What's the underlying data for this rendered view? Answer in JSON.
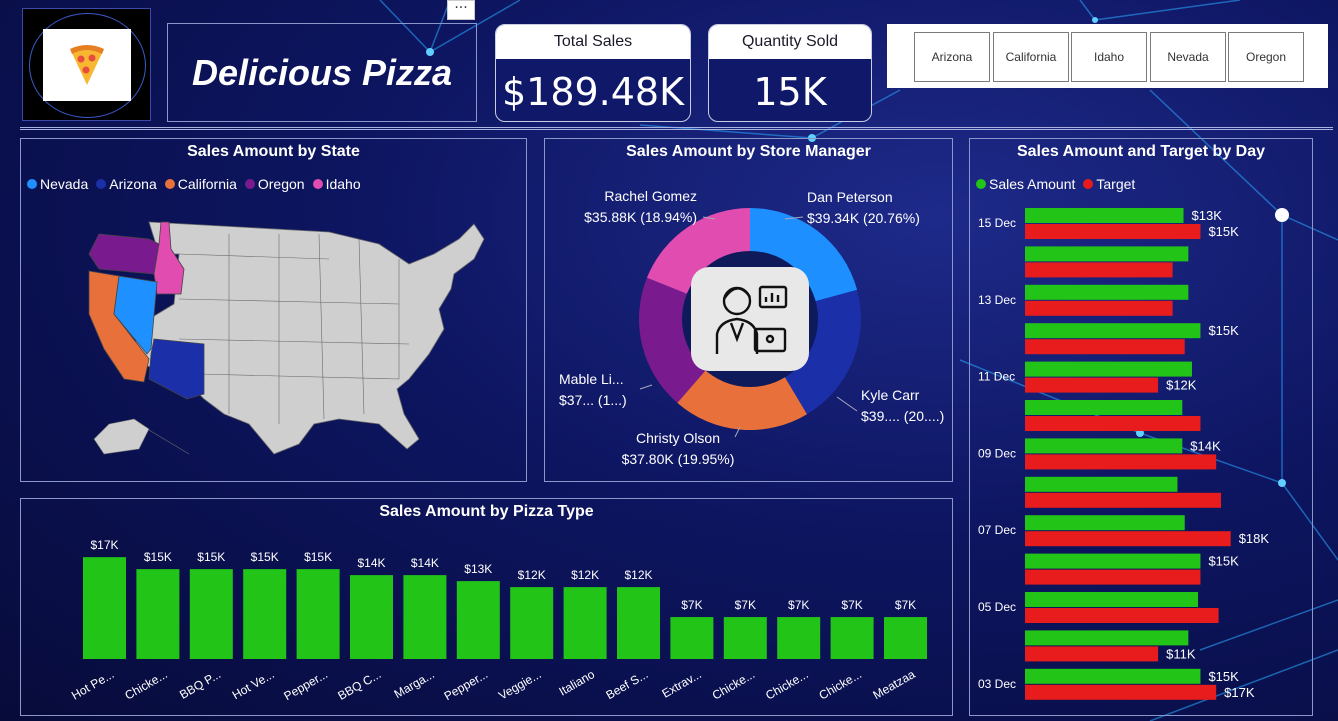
{
  "header": {
    "title": "Delicious Pizza",
    "logo_icon": "pizza-icon",
    "more_options": "···"
  },
  "kpis": [
    {
      "label": "Total Sales",
      "value": "$189.48K"
    },
    {
      "label": "Quantity Sold",
      "value": "15K"
    }
  ],
  "slicer": {
    "states": [
      "Arizona",
      "California",
      "Idaho",
      "Nevada",
      "Oregon"
    ]
  },
  "map_panel": {
    "title": "Sales Amount by State",
    "legend": [
      {
        "label": "Nevada",
        "color": "#1e90ff"
      },
      {
        "label": "Arizona",
        "color": "#1a2fa8"
      },
      {
        "label": "California",
        "color": "#e8703a"
      },
      {
        "label": "Oregon",
        "color": "#7a1a8f"
      },
      {
        "label": "Idaho",
        "color": "#e04cb0"
      }
    ]
  },
  "donut_panel": {
    "title": "Sales Amount by Store Manager",
    "center_icon": "business-person-icon",
    "slices": [
      {
        "name": "Dan Peterson",
        "value_label": "$39.34K (20.76%)",
        "value": 39.34,
        "color": "#1e8fff"
      },
      {
        "name": "Kyle Carr",
        "value_label": "$39.... (20....)",
        "value": 39.1,
        "color": "#1a2fa8"
      },
      {
        "name": "Christy Olson",
        "value_label": "$37.80K (19.95%)",
        "value": 37.8,
        "color": "#e8703a"
      },
      {
        "name": "Mable Li...",
        "value_label": "$37... (1...)",
        "value": 37.3,
        "color": "#7a1a8f"
      },
      {
        "name": "Rachel Gomez",
        "value_label": "$35.88K (18.94%)",
        "value": 35.88,
        "color": "#e04cb0"
      }
    ]
  },
  "pizza_panel": {
    "title": "Sales Amount by Pizza Type"
  },
  "day_panel": {
    "title": "Sales Amount and Target by Day",
    "legend": [
      {
        "label": "Sales Amount",
        "color": "#22c418"
      },
      {
        "label": "Target",
        "color": "#e81c1c"
      }
    ]
  },
  "chart_data": [
    {
      "type": "bar",
      "title": "Sales Amount by Pizza Type",
      "categories": [
        "Hot Pe...",
        "Chicke...",
        "BBQ P...",
        "Hot Ve...",
        "Pepper...",
        "BBQ C...",
        "Marga...",
        "Pepper...",
        "Veggie...",
        "Italiano",
        "Beef S...",
        "Extrav...",
        "Chicke...",
        "Chicke...",
        "Chicke...",
        "Meatzaa"
      ],
      "values": [
        17,
        15,
        15,
        15,
        15,
        14,
        14,
        13,
        12,
        12,
        12,
        7,
        7,
        7,
        7,
        7
      ],
      "value_labels": [
        "$17K",
        "$15K",
        "$15K",
        "$15K",
        "$15K",
        "$14K",
        "$14K",
        "$13K",
        "$12K",
        "$12K",
        "$12K",
        "$7K",
        "$7K",
        "$7K",
        "$7K",
        "$7K"
      ],
      "color": "#22c418",
      "ylim": [
        0,
        20
      ]
    },
    {
      "type": "bar",
      "orientation": "horizontal",
      "title": "Sales Amount and Target by Day",
      "y_tick_labels": [
        "15 Dec",
        "13 Dec",
        "11 Dec",
        "09 Dec",
        "07 Dec",
        "05 Dec",
        "03 Dec"
      ],
      "rows": 13,
      "series": [
        {
          "name": "Sales Amount",
          "color": "#22c418",
          "values": [
            13.1,
            13.5,
            13.5,
            14.5,
            13.8,
            13.0,
            13.0,
            12.6,
            13.2,
            14.5,
            14.3,
            13.5,
            14.5
          ],
          "labels": [
            "$13K",
            "",
            "",
            "$15K",
            "",
            "",
            "$14K",
            "",
            "",
            "$15K",
            "",
            "",
            "$15K"
          ]
        },
        {
          "name": "Target",
          "color": "#e81c1c",
          "values": [
            14.5,
            12.2,
            12.2,
            13.2,
            11.0,
            14.5,
            15.8,
            16.2,
            17.0,
            14.5,
            16.0,
            11.0,
            15.8
          ],
          "labels": [
            "$15K",
            "",
            "",
            "",
            "$12K",
            "",
            "",
            "",
            "$18K",
            "",
            "",
            "$11K",
            "$17K"
          ]
        }
      ],
      "xlim": [
        0,
        20
      ]
    }
  ]
}
